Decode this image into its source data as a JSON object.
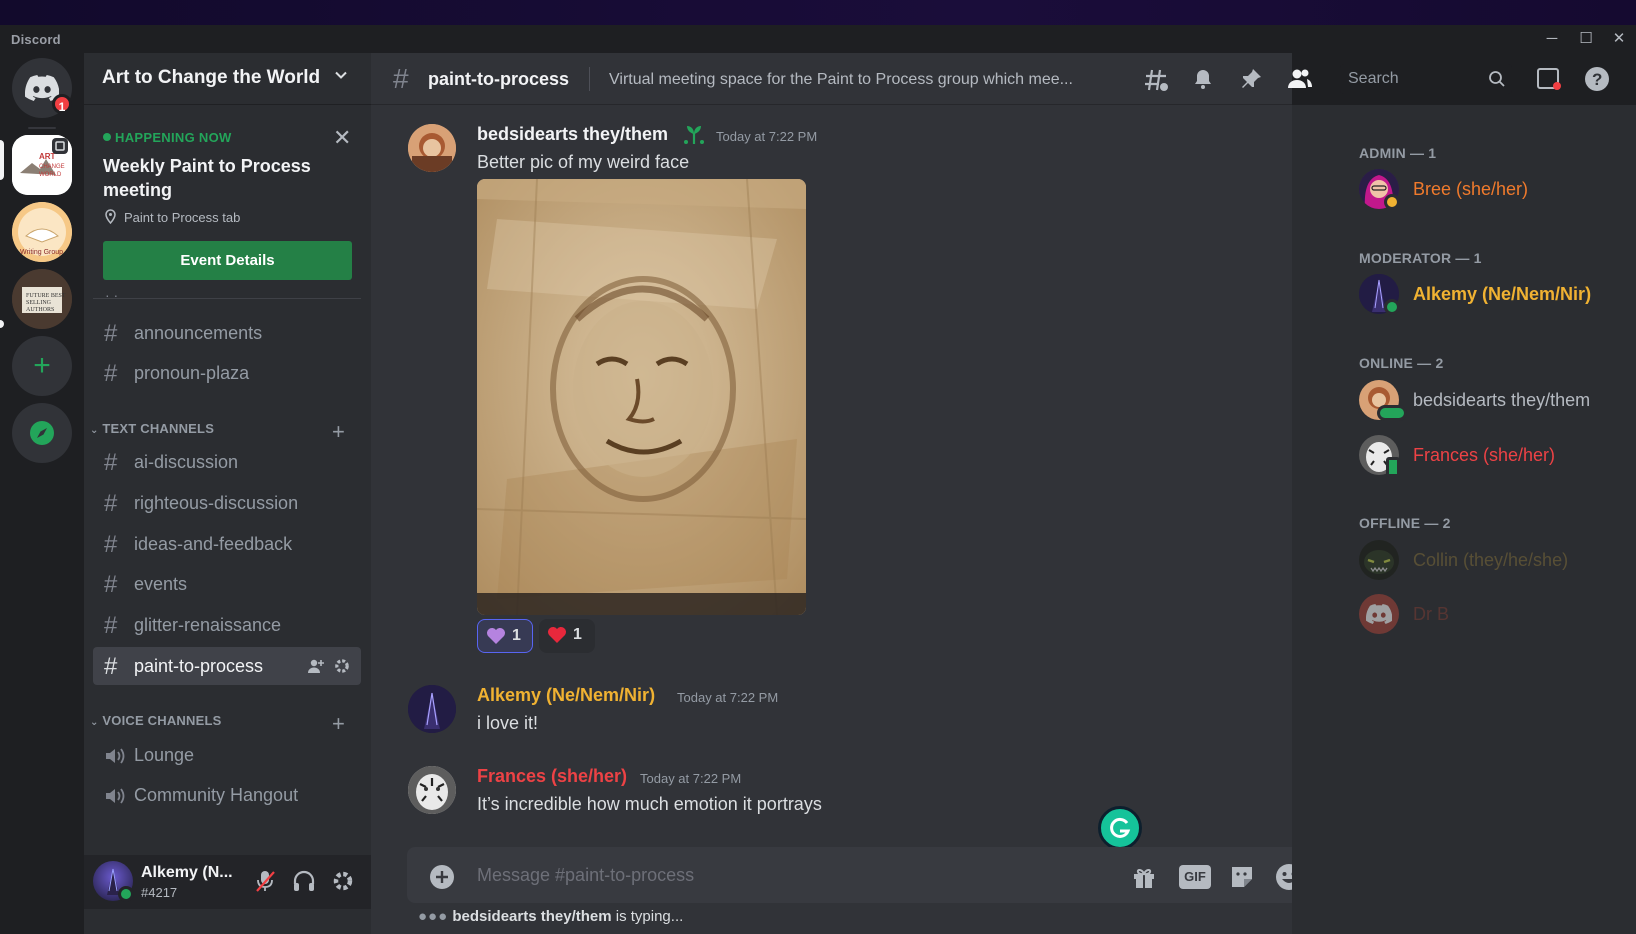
{
  "app": {
    "title": "Discord"
  },
  "servers": {
    "home_badge": "1"
  },
  "guild": {
    "name": "Art to Change the World"
  },
  "event": {
    "status": "HAPPENING NOW",
    "title": "Weekly Paint to Process meeting",
    "location": "Paint to Process tab",
    "button": "Event Details"
  },
  "channels_top": [
    {
      "name": "announcements"
    },
    {
      "name": "pronoun-plaza"
    }
  ],
  "text_category": "TEXT CHANNELS",
  "text_channels": [
    {
      "name": "ai-discussion"
    },
    {
      "name": "righteous-discussion"
    },
    {
      "name": "ideas-and-feedback"
    },
    {
      "name": "events"
    },
    {
      "name": "glitter-renaissance"
    },
    {
      "name": "paint-to-process"
    }
  ],
  "voice_category": "VOICE CHANNELS",
  "voice_channels": [
    {
      "name": "Lounge"
    },
    {
      "name": "Community Hangout"
    }
  ],
  "user": {
    "name": "Alkemy (N...",
    "tag": "#4217"
  },
  "channel": {
    "name": "paint-to-process",
    "topic": "Virtual meeting space for the Paint to Process group which mee...",
    "search_placeholder": "Search"
  },
  "messages": [
    {
      "author": "bedsidearts they/them",
      "time": "Today at 7:22 PM",
      "text": "Better pic of my weird face",
      "color": "#f2f3f5"
    },
    {
      "author": "Alkemy (Ne/Nem/Nir)",
      "time": "Today at 7:22 PM",
      "text": "i love it!",
      "color": "#f0b232"
    },
    {
      "author": "Frances (she/her)",
      "time": "Today at 7:22 PM",
      "text": "It’s incredible how much emotion it portrays",
      "color": "#ed4245"
    }
  ],
  "reactions": [
    {
      "emoji": "💜",
      "count": "1"
    },
    {
      "emoji": "❤️",
      "count": "1"
    }
  ],
  "composer": {
    "placeholder": "Message #paint-to-process",
    "gif": "GIF",
    "typing_user": "bedsidearts they/them",
    "typing_suffix": " is typing..."
  },
  "members": {
    "groups": [
      {
        "label": "ADMIN — 1",
        "members": [
          {
            "name": "Bree (she/her)",
            "color": "#f07a2c"
          }
        ]
      },
      {
        "label": "MODERATOR — 1",
        "members": [
          {
            "name": "Alkemy (Ne/Nem/Nir)",
            "color": "#f0b232"
          }
        ]
      },
      {
        "label": "ONLINE — 2",
        "members": [
          {
            "name": "bedsidearts they/them",
            "color": "#b5bac1"
          },
          {
            "name": "Frances (she/her)",
            "color": "#ed4245"
          }
        ]
      },
      {
        "label": "OFFLINE — 2",
        "members": [
          {
            "name": "Collin (they/he/she)",
            "color": "#7d6b3a"
          },
          {
            "name": "Dr B",
            "color": "#7a3d33"
          }
        ]
      }
    ]
  }
}
